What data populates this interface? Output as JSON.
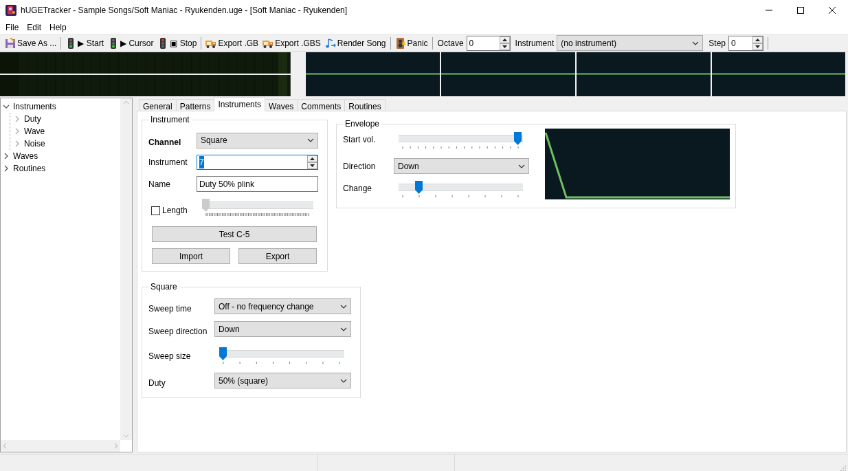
{
  "window": {
    "title": "hUGETracker - Sample Songs/Soft Maniac - Ryukenden.uge - [Soft Maniac - Ryukenden]"
  },
  "menu": [
    "File",
    "Edit",
    "Help"
  ],
  "toolbar": [
    {
      "kind": "save",
      "label": "Save As ..."
    },
    {
      "kind": "separator"
    },
    {
      "kind": "start",
      "label": "▶ Start"
    },
    {
      "kind": "cursor",
      "label": "▶ Cursor"
    },
    {
      "kind": "stop",
      "label": "▣ Stop"
    },
    {
      "kind": "separator"
    },
    {
      "kind": "export",
      "label": "Export .GB"
    },
    {
      "kind": "export",
      "label": "Export .GBS"
    },
    {
      "kind": "render",
      "label": "Render Song"
    },
    {
      "kind": "separator"
    },
    {
      "kind": "panic",
      "label": "Panic"
    },
    {
      "kind": "separator"
    },
    {
      "kind": "label",
      "text": "Octave"
    },
    {
      "kind": "spin",
      "value": "0"
    },
    {
      "kind": "label",
      "text": "Instrument"
    },
    {
      "kind": "select",
      "value": "(no instrument)"
    },
    {
      "kind": "label",
      "text": "Step"
    },
    {
      "kind": "spin",
      "value": "0"
    },
    {
      "kind": "separator"
    }
  ],
  "tree": [
    {
      "label": "Instruments",
      "expanded": true,
      "children": [
        {
          "label": "Duty",
          "expanded": false
        },
        {
          "label": "Wave",
          "expanded": false
        },
        {
          "label": "Noise",
          "expanded": false
        }
      ]
    },
    {
      "label": "Waves",
      "expanded": false
    },
    {
      "label": "Routines",
      "expanded": false
    }
  ],
  "tabs": [
    {
      "label": "General",
      "selected": false
    },
    {
      "label": "Patterns",
      "selected": false
    },
    {
      "label": "Instruments",
      "selected": true
    },
    {
      "label": "Waves",
      "selected": false
    },
    {
      "label": "Comments",
      "selected": false
    },
    {
      "label": "Routines",
      "selected": false
    }
  ],
  "instrument_group": {
    "title": "Instrument",
    "rows": [
      {
        "kind": "select",
        "label": "Channel",
        "bold": true,
        "value": "Square"
      },
      {
        "kind": "spin",
        "label": "Instrument",
        "bold": false,
        "value": "7",
        "highlighted": true
      },
      {
        "kind": "text",
        "label": "Name",
        "bold": false,
        "value": "Duty 50% plink"
      },
      {
        "kind": "check_slider",
        "label": "Length",
        "checked": false,
        "disabled": true,
        "level": 0
      }
    ],
    "test_button": "Test C-5",
    "import_button": "Import",
    "export_button": "Export"
  },
  "envelope_group": {
    "title": "Envelope",
    "rows": [
      {
        "kind": "slider",
        "label": "Start vol.",
        "disabled": false,
        "level": 1
      },
      {
        "kind": "select",
        "label": "Direction",
        "value": "Down"
      },
      {
        "kind": "slider",
        "label": "Change",
        "disabled": false,
        "level": 0.143
      }
    ]
  },
  "square_group": {
    "title": "Square",
    "rows": [
      {
        "kind": "select",
        "label": "Sweep time",
        "value": "Off - no frequency change"
      },
      {
        "kind": "select",
        "label": "Sweep direction",
        "value": "Down"
      },
      {
        "kind": "slider",
        "label": "Sweep size",
        "disabled": false,
        "level": 0
      },
      {
        "kind": "select",
        "label": "Duty",
        "value": "50% (square)"
      }
    ]
  }
}
